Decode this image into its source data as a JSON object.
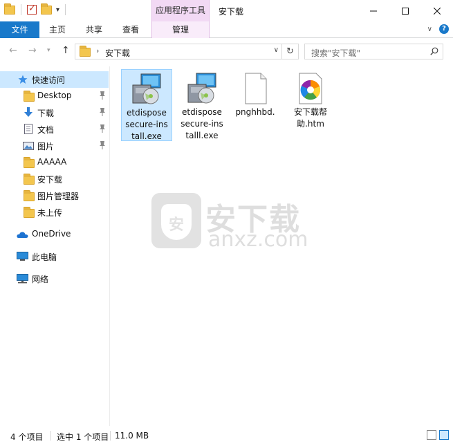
{
  "window": {
    "title": "安下载",
    "contextual_group": "应用程序工具",
    "controls": [
      "minimize",
      "maximize",
      "close"
    ]
  },
  "ribbon": {
    "file_tab": "文件",
    "tabs": [
      "主页",
      "共享",
      "查看"
    ],
    "contextual_tab": "管理"
  },
  "address": {
    "path": "安下载",
    "search_placeholder": "搜索\"安下载\""
  },
  "nav": {
    "quick_access": "快速访问",
    "pinned": [
      {
        "label": "Desktop",
        "icon": "folder-icon"
      },
      {
        "label": "下载",
        "icon": "download-arrow-icon"
      },
      {
        "label": "文档",
        "icon": "document-icon"
      },
      {
        "label": "图片",
        "icon": "picture-icon"
      }
    ],
    "folders": [
      "AAAAA",
      "安下载",
      "图片管理器",
      "未上传"
    ],
    "onedrive": "OneDrive",
    "this_pc": "此电脑",
    "network": "网络"
  },
  "files": [
    {
      "name": "etdispose\nsecure-ins\ntall.exe",
      "icon": "installer-icon",
      "selected": true
    },
    {
      "name": "etdispose\nsecure-ins\ntalll.exe",
      "icon": "installer-icon",
      "selected": false
    },
    {
      "name": "pnghhbd.",
      "icon": "blank-file-icon",
      "selected": false
    },
    {
      "name": "安下载帮\n助.htm",
      "icon": "browser-html-icon",
      "selected": false
    }
  ],
  "watermark": {
    "cn": "安下载",
    "en": "anxz.com",
    "shield_char": "安"
  },
  "status": {
    "count": "4 个项目",
    "selected": "选中 1 个项目",
    "size": "11.0 MB"
  },
  "colors": {
    "accent": "#1979ca",
    "selection": "#cce8ff",
    "contextual": "#f2d9f4"
  }
}
